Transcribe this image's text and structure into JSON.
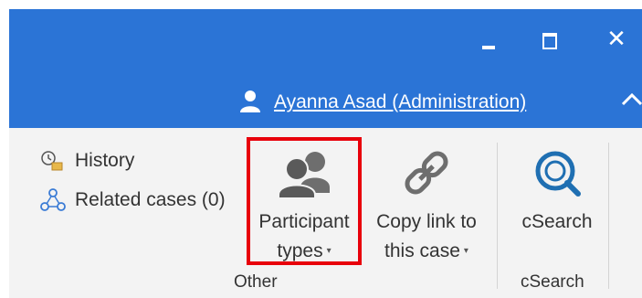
{
  "window": {
    "close_glyph": "✕",
    "accent_color": "#2b74d6"
  },
  "user": {
    "name": "Ayanna Asad (Administration)"
  },
  "ribbon": {
    "history_label": "History",
    "related_cases_label": "Related cases (0)",
    "participant_types": {
      "line1": "Participant",
      "line2": "types"
    },
    "copy_link": {
      "line1": "Copy link to",
      "line2": "this case"
    },
    "csearch_button": "cSearch",
    "groups": {
      "other": "Other",
      "csearch": "cSearch"
    },
    "dropdown_glyph": "▾",
    "highlight_color": "#e8000b"
  }
}
